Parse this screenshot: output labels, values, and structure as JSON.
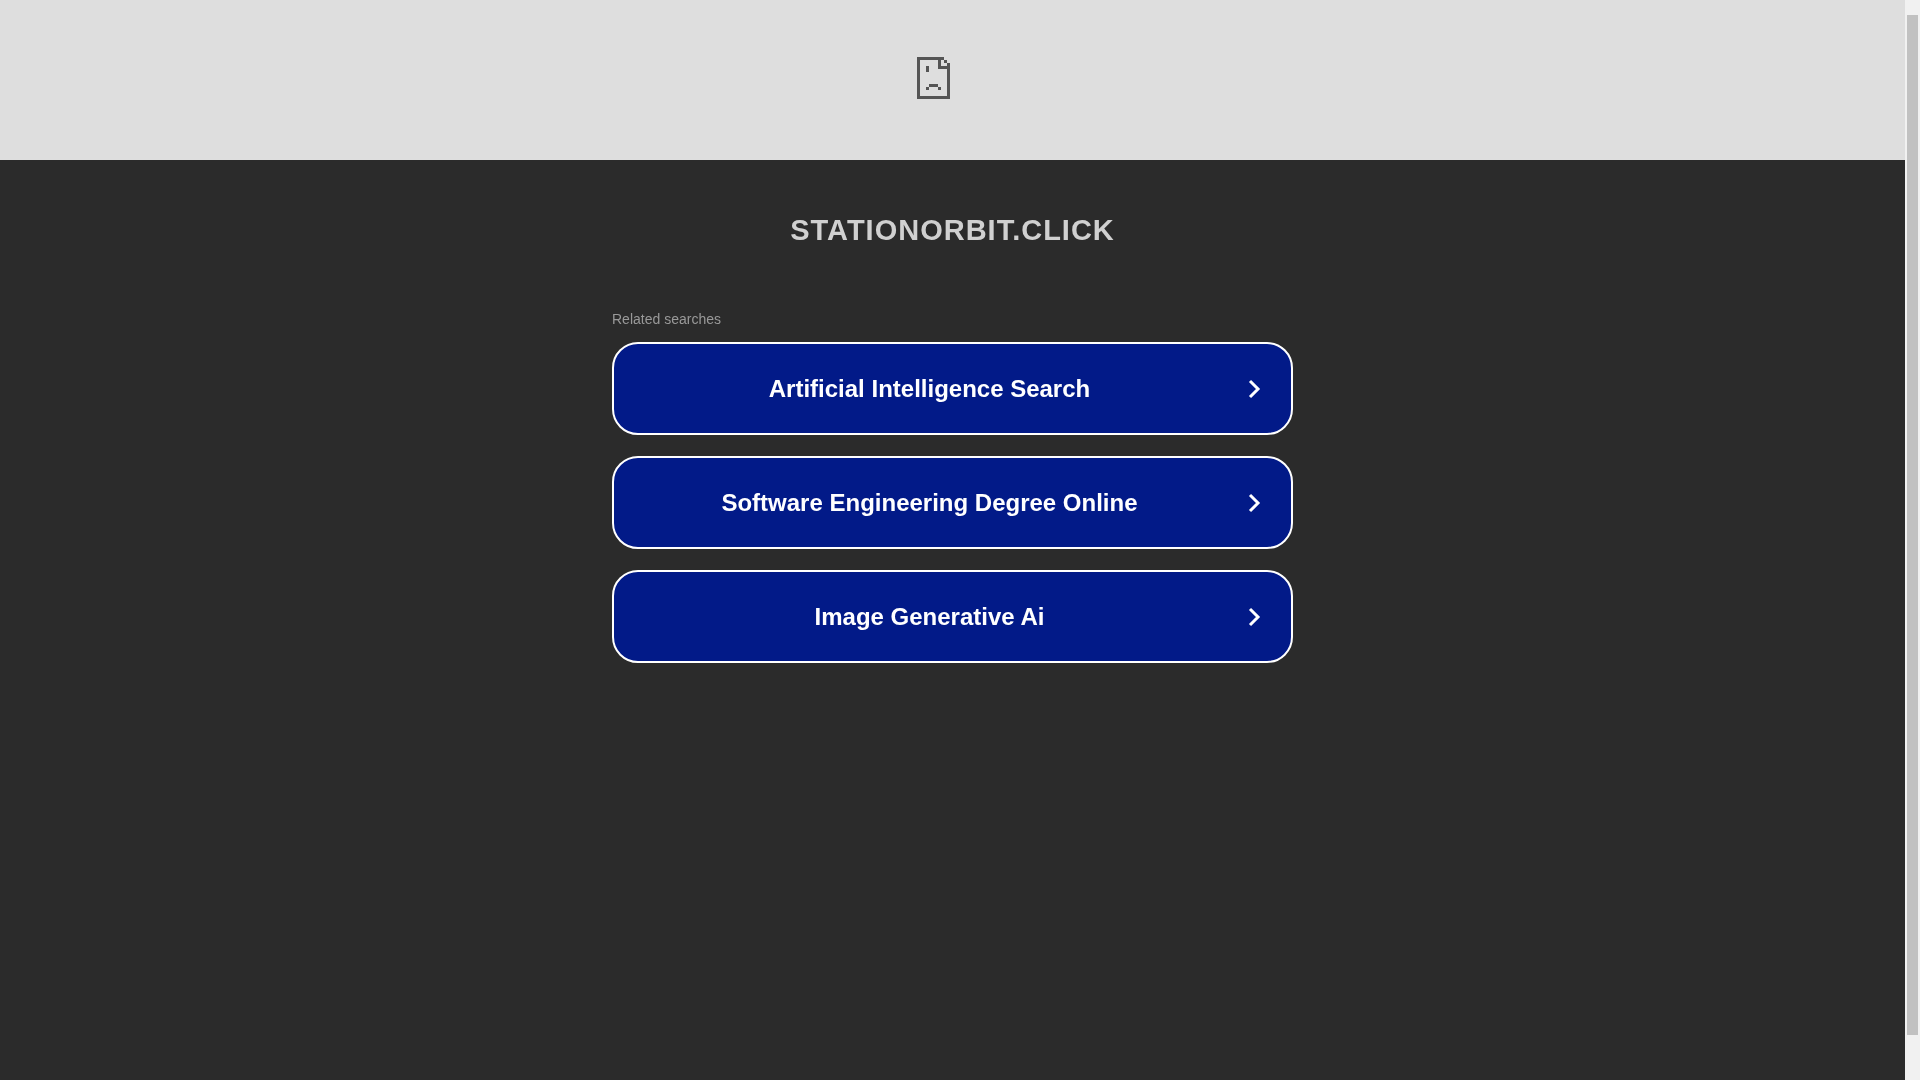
{
  "header": {
    "domain": "STATIONORBIT.CLICK"
  },
  "related": {
    "heading": "Related searches",
    "links": [
      {
        "label": "Artificial Intelligence Search"
      },
      {
        "label": "Software Engineering Degree Online"
      },
      {
        "label": "Image Generative Ai"
      }
    ]
  }
}
